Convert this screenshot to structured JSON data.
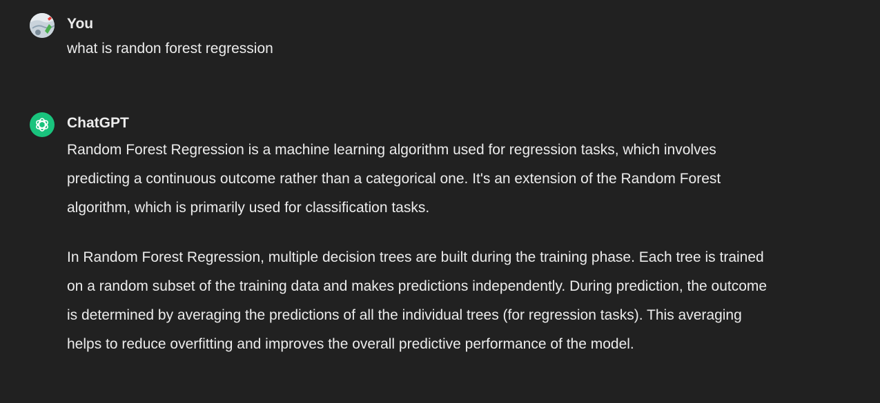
{
  "conversation": {
    "user_message": {
      "author": "You",
      "text": "what is randon forest regression",
      "avatar_icon": "user-photo-avatar"
    },
    "assistant_message": {
      "author": "ChatGPT",
      "avatar_icon": "openai-logo-icon",
      "avatar_color": "#19c37d",
      "paragraphs": [
        "Random Forest Regression is a machine learning algorithm used for regression tasks, which involves predicting a continuous outcome rather than a categorical one. It's an extension of the Random Forest algorithm, which is primarily used for classification tasks.",
        "In Random Forest Regression, multiple decision trees are built during the training phase. Each tree is trained on a random subset of the training data and makes predictions independently. During prediction, the outcome is determined by averaging the predictions of all the individual trees (for regression tasks). This averaging helps to reduce overfitting and improves the overall predictive performance of the model."
      ]
    }
  },
  "colors": {
    "background": "#212121",
    "text": "#ececec",
    "brand": "#19c37d"
  }
}
